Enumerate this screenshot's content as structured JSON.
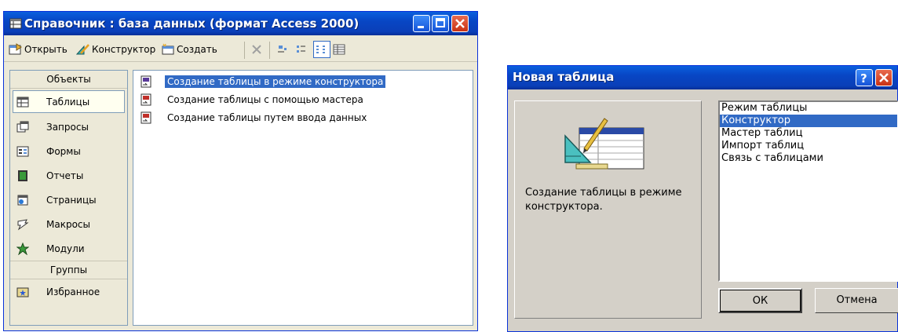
{
  "window": {
    "title": "Справочник : база данных (формат Access 2000)"
  },
  "toolbar": {
    "open": "Открыть",
    "designer": "Конструктор",
    "create": "Создать"
  },
  "sidebar": {
    "objects_header": "Объекты",
    "items": [
      {
        "label": "Таблицы",
        "icon": "table-icon",
        "selected": true
      },
      {
        "label": "Запросы",
        "icon": "query-icon"
      },
      {
        "label": "Формы",
        "icon": "form-icon"
      },
      {
        "label": "Отчеты",
        "icon": "report-icon"
      },
      {
        "label": "Страницы",
        "icon": "page-icon"
      },
      {
        "label": "Макросы",
        "icon": "macro-icon"
      },
      {
        "label": "Модули",
        "icon": "module-icon"
      }
    ],
    "groups_header": "Группы",
    "group_items": [
      {
        "label": "Избранное",
        "icon": "favorites-icon"
      }
    ]
  },
  "list": {
    "items": [
      {
        "label": "Создание таблицы в режиме конструктора",
        "selected": true
      },
      {
        "label": "Создание таблицы с помощью мастера"
      },
      {
        "label": "Создание таблицы путем ввода данных"
      }
    ]
  },
  "dialog": {
    "title": "Новая таблица",
    "description": "Создание таблицы в режиме конструктора.",
    "options": [
      {
        "label": "Режим таблицы"
      },
      {
        "label": "Конструктор",
        "selected": true
      },
      {
        "label": "Мастер таблиц"
      },
      {
        "label": "Импорт таблиц"
      },
      {
        "label": "Связь с таблицами"
      }
    ],
    "ok_label": "ОК",
    "cancel_label": "Отмена"
  },
  "colors": {
    "titlebar": "#0a46c4",
    "selection": "#316ac5",
    "face": "#ece9d8"
  }
}
